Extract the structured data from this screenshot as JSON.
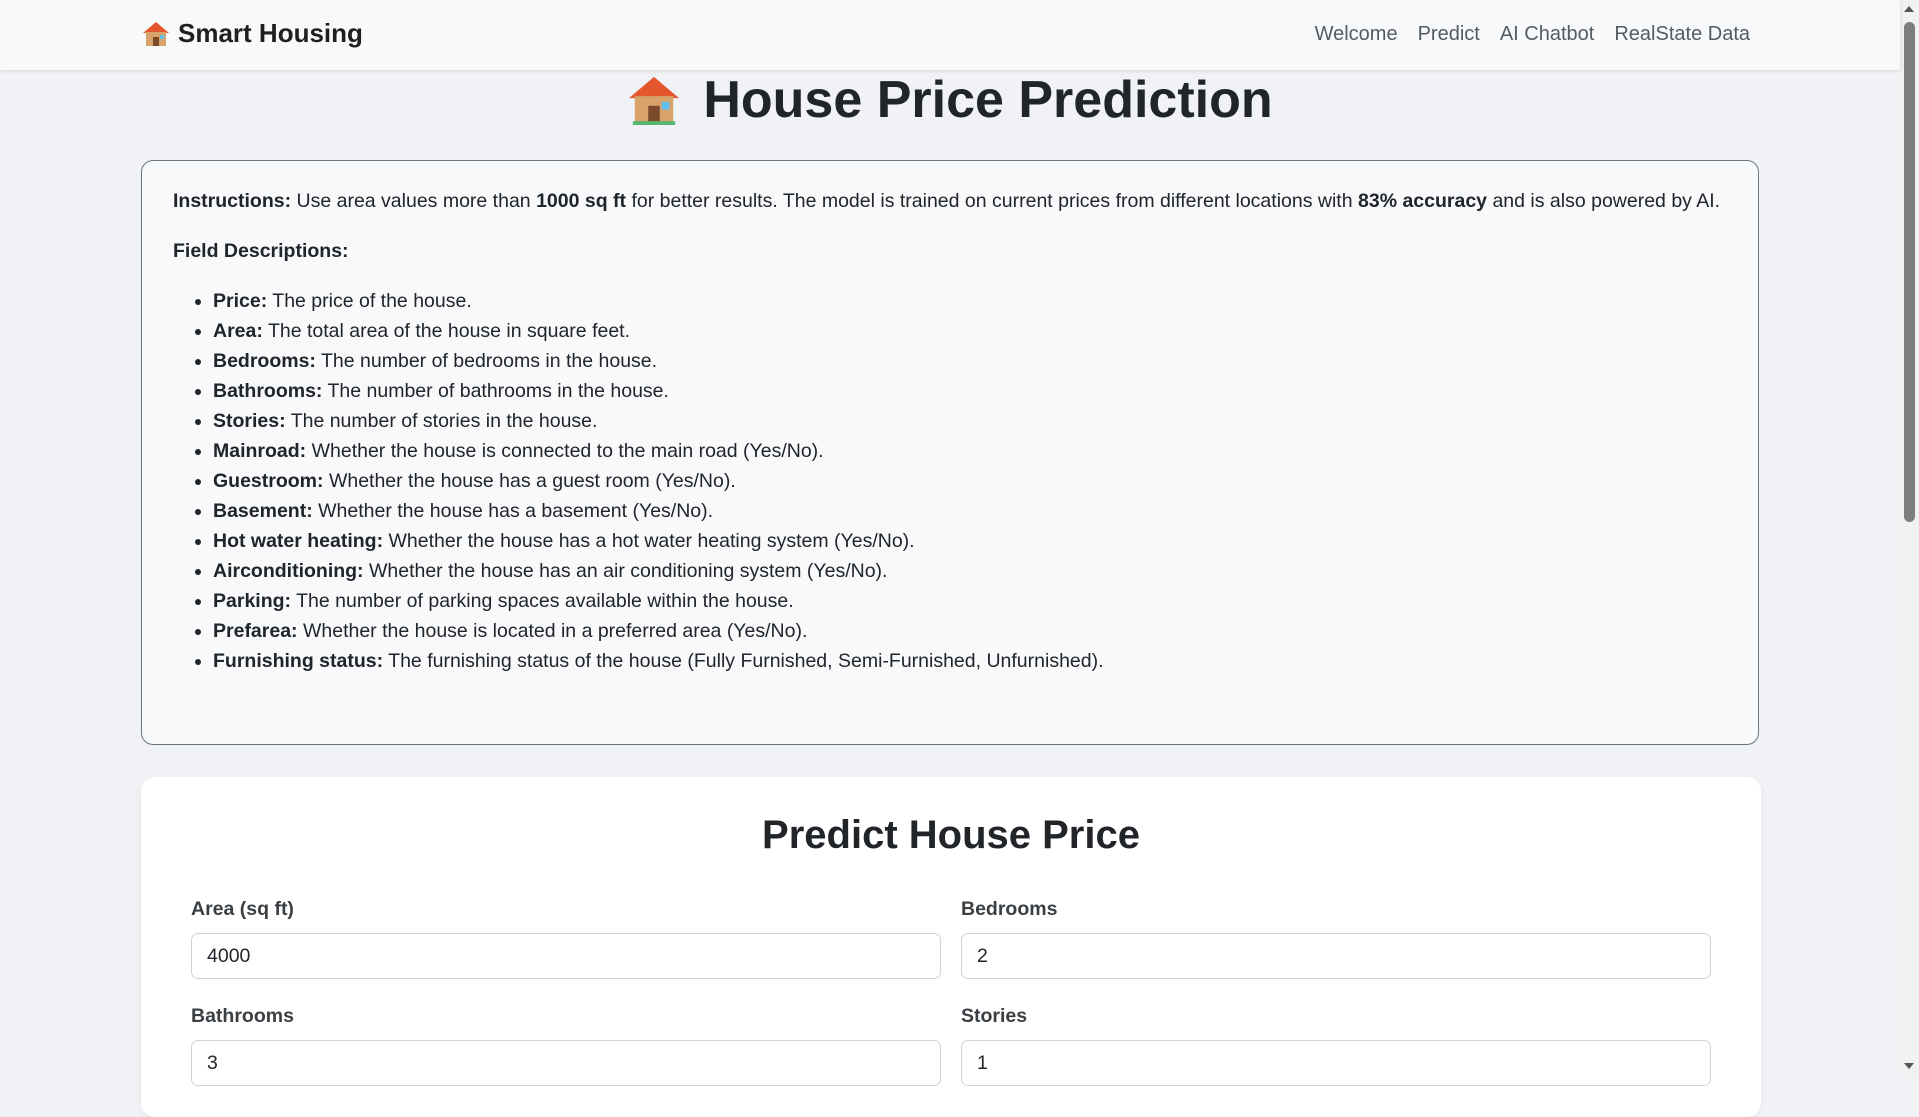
{
  "navbar": {
    "brand": "Smart Housing",
    "links": [
      "Welcome",
      "Predict",
      "AI Chatbot",
      "RealState Data"
    ]
  },
  "page_title": "House Price Prediction",
  "instructions": {
    "label": "Instructions:",
    "text1": "Use area values more than",
    "area_highlight": "1000 sq ft",
    "text2": "for better results. The model is trained on current prices from different locations with",
    "accuracy_highlight": "83% accuracy",
    "text3": "and is also powered by AI.",
    "desc_title": "Field Descriptions:",
    "fields": [
      {
        "name": "Price:",
        "desc": "The price of the house."
      },
      {
        "name": "Area:",
        "desc": "The total area of the house in square feet."
      },
      {
        "name": "Bedrooms:",
        "desc": "The number of bedrooms in the house."
      },
      {
        "name": "Bathrooms:",
        "desc": "The number of bathrooms in the house."
      },
      {
        "name": "Stories:",
        "desc": "The number of stories in the house."
      },
      {
        "name": "Mainroad:",
        "desc": "Whether the house is connected to the main road (Yes/No)."
      },
      {
        "name": "Guestroom:",
        "desc": "Whether the house has a guest room (Yes/No)."
      },
      {
        "name": "Basement:",
        "desc": "Whether the house has a basement (Yes/No)."
      },
      {
        "name": "Hot water heating:",
        "desc": "Whether the house has a hot water heating system (Yes/No)."
      },
      {
        "name": "Airconditioning:",
        "desc": "Whether the house has an air conditioning system (Yes/No)."
      },
      {
        "name": "Parking:",
        "desc": "The number of parking spaces available within the house."
      },
      {
        "name": "Prefarea:",
        "desc": "Whether the house is located in a preferred area (Yes/No)."
      },
      {
        "name": "Furnishing status:",
        "desc": "The furnishing status of the house (Fully Furnished, Semi-Furnished, Unfurnished)."
      }
    ]
  },
  "form": {
    "title": "Predict House Price",
    "area_label": "Area (sq ft)",
    "area_value": "4000",
    "bedrooms_label": "Bedrooms",
    "bedrooms_value": "2",
    "bathrooms_label": "Bathrooms",
    "bathrooms_value": "3",
    "stories_label": "Stories",
    "stories_value": "1"
  },
  "icons": {
    "brand": "house-icon",
    "title": "house-icon"
  }
}
